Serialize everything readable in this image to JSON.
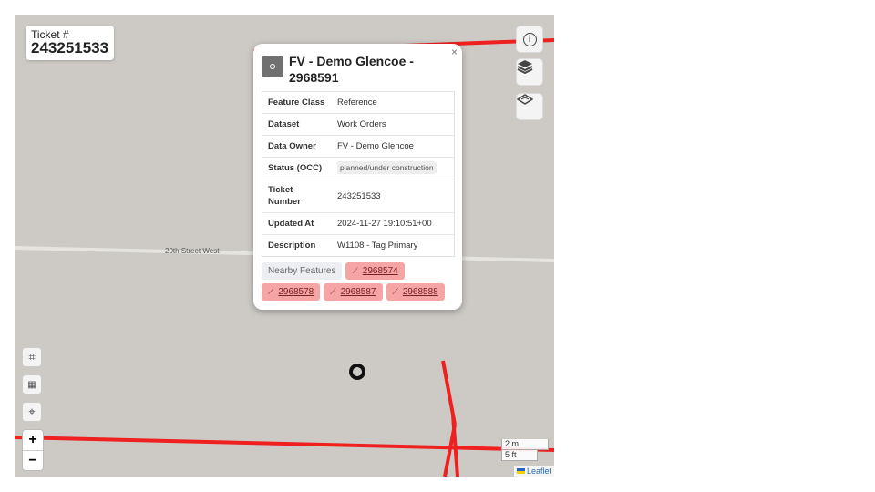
{
  "ticket": {
    "label": "Ticket #",
    "number": "243251533"
  },
  "map": {
    "street_label": "20th Street West",
    "line_color": "#ee2020",
    "scale": {
      "metric": "2 m",
      "imperial": "5 ft"
    },
    "attribution": "Leaflet"
  },
  "controls": {
    "right": [
      "info-icon",
      "layers-icon",
      "basemap-icon"
    ],
    "left": [
      "crop-icon",
      "map-select-icon",
      "locate-icon"
    ],
    "zoom_in": "+",
    "zoom_out": "−"
  },
  "popup": {
    "close": "×",
    "title": "FV - Demo Glencoe - 2968591",
    "rows": [
      {
        "key": "Feature Class",
        "value": "Reference"
      },
      {
        "key": "Dataset",
        "value": "Work Orders"
      },
      {
        "key": "Data Owner",
        "value": "FV - Demo Glencoe"
      },
      {
        "key": "Status (OCC)",
        "value": "planned/under construction"
      },
      {
        "key": "Ticket Number",
        "value": "243251533"
      },
      {
        "key": "Updated At",
        "value": "2024-11-27 19:10:51+00"
      },
      {
        "key": "Description",
        "value": "W1108 - Tag Primary"
      }
    ],
    "nearby_label": "Nearby Features",
    "nearby": [
      "2968574",
      "2968578",
      "2968587",
      "2968588"
    ]
  }
}
